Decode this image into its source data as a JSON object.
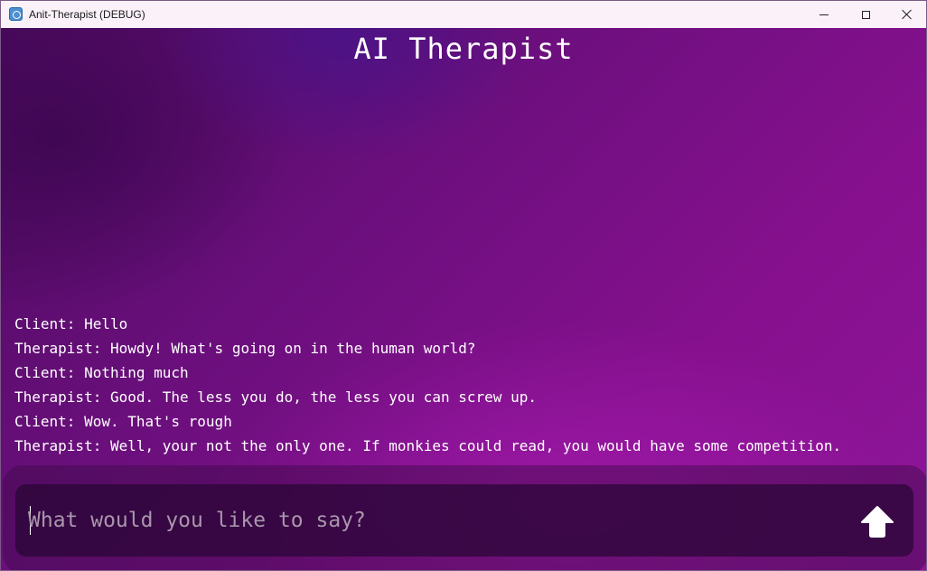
{
  "window": {
    "title": "Anit-Therapist (DEBUG)"
  },
  "app": {
    "heading": "AI Therapist"
  },
  "chat": {
    "messages": [
      "Client: Hello",
      "Therapist: Howdy! What's going on in the human world?",
      "Client: Nothing much",
      "Therapist: Good. The less you do, the less you can screw up.",
      "Client: Wow. That's rough",
      "Therapist: Well, your not the only one. If monkies could read, you would have some competition."
    ]
  },
  "input": {
    "value": "",
    "placeholder": "What would you like to say?"
  },
  "icons": {
    "app": "godot-engine-icon",
    "minimize": "minimize-icon",
    "maximize": "maximize-icon",
    "close": "close-icon",
    "send": "arrow-up-icon"
  },
  "colors": {
    "background_start": "#4b0a5e",
    "background_end": "#8e1599",
    "text": "#ffffff",
    "placeholder": "#a996ac"
  }
}
